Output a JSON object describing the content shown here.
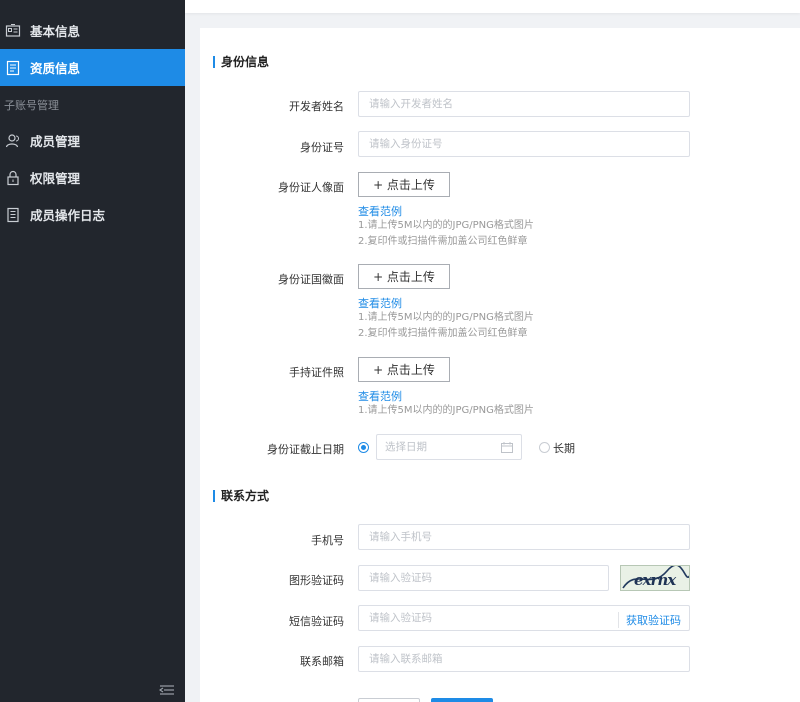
{
  "sidebar": {
    "items": [
      {
        "label": "基本信息",
        "icon": "id-card-icon"
      },
      {
        "label": "资质信息",
        "icon": "document-icon",
        "active": true
      }
    ],
    "group_label": "子账号管理",
    "group_items": [
      {
        "label": "成员管理",
        "icon": "users-icon"
      },
      {
        "label": "权限管理",
        "icon": "lock-icon"
      },
      {
        "label": "成员操作日志",
        "icon": "log-icon"
      }
    ],
    "collapse_icon": "menu-collapse-icon"
  },
  "identity": {
    "title": "身份信息",
    "name_label": "开发者姓名",
    "name_placeholder": "请输入开发者姓名",
    "idno_label": "身份证号",
    "idno_placeholder": "请输入身份证号",
    "front_label": "身份证人像面",
    "back_label": "身份证国徽面",
    "hand_label": "手持证件照",
    "upload_label": "+ 点击上传",
    "example_link": "查看范例",
    "hint_size": "1.请上传5M以内的的JPG/PNG格式图片",
    "hint_seal": "2.复印件或扫描件需加盖公司红色鲜章",
    "expiry_label": "身份证截止日期",
    "date_placeholder": "选择日期",
    "longterm_label": "长期"
  },
  "contact": {
    "title": "联系方式",
    "phone_label": "手机号",
    "phone_placeholder": "请输入手机号",
    "captcha_label": "图形验证码",
    "captcha_placeholder": "请输入验证码",
    "captcha_text": "exrnx",
    "sms_label": "短信验证码",
    "sms_placeholder": "请输入验证码",
    "sms_button": "获取验证码",
    "email_label": "联系邮箱",
    "email_placeholder": "请输入联系邮箱"
  },
  "colors": {
    "sidebar_bg": "#22262d",
    "accent": "#1e8be6"
  }
}
